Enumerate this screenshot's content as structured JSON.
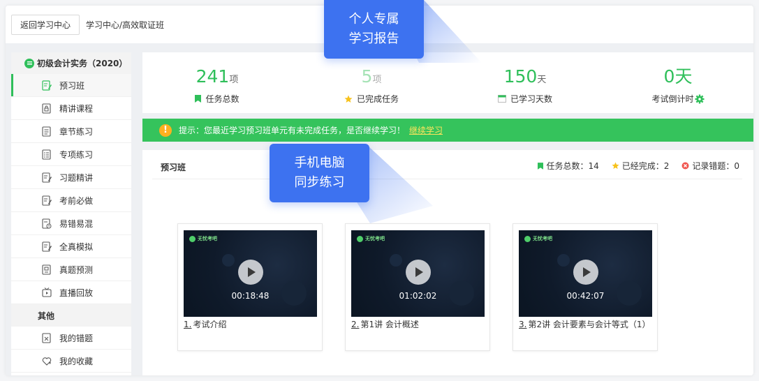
{
  "topbar": {
    "back_label": "返回学习中心",
    "breadcrumb": "学习中心/高效取证班"
  },
  "sidebar": {
    "course_title": "初级会计实务（2020）",
    "items": [
      {
        "label": "预习班",
        "icon": "edit-note-icon",
        "active": true
      },
      {
        "label": "精讲课程",
        "icon": "doc-lock-icon"
      },
      {
        "label": "章节练习",
        "icon": "doc-lines-icon"
      },
      {
        "label": "专项练习",
        "icon": "doc-list-icon"
      },
      {
        "label": "习题精讲",
        "icon": "doc-pen-icon"
      },
      {
        "label": "考前必做",
        "icon": "doc-pen-icon"
      },
      {
        "label": "易错易混",
        "icon": "doc-clock-icon"
      },
      {
        "label": "全真模拟",
        "icon": "doc-pen-icon"
      },
      {
        "label": "真题预测",
        "icon": "doc-box-icon"
      },
      {
        "label": "直播回放",
        "icon": "tv-icon"
      }
    ],
    "other_group": "其他",
    "other_items": [
      {
        "label": "我的错题",
        "icon": "doc-x-icon"
      },
      {
        "label": "我的收藏",
        "icon": "heart-plus-icon"
      }
    ]
  },
  "stats": [
    {
      "value": "241",
      "unit": "项",
      "label": "任务总数",
      "icon": "bookmark-icon",
      "faded": false
    },
    {
      "value": "5",
      "unit": "项",
      "label": "已完成任务",
      "icon": "star-icon",
      "faded": true
    },
    {
      "value": "150",
      "unit": "天",
      "label": "已学习天数",
      "icon": "calendar-icon",
      "faded": false
    },
    {
      "value": "0天",
      "unit": "",
      "label": "考试倒计时",
      "icon": "gear-icon",
      "faded": false
    }
  ],
  "banner": {
    "text": "提示：您最近学习预习班单元有未完成任务，是否继续学习！",
    "link": "继续学习"
  },
  "panel": {
    "title": "预习班",
    "counts": [
      {
        "label": "任务总数：14",
        "icon": "bookmark-icon"
      },
      {
        "label": "已经完成：2",
        "icon": "star-icon"
      },
      {
        "label": "记录错题：0",
        "icon": "error-circle-icon"
      }
    ],
    "cards": [
      {
        "index": "1.",
        "title": "考试介绍",
        "duration": "00:18:48",
        "logo": "无忧考吧"
      },
      {
        "index": "2.",
        "title": "第1讲 会计概述",
        "duration": "01:02:02",
        "logo": "无忧考吧"
      },
      {
        "index": "3.",
        "title": "第2讲 会计要素与会计等式（1）",
        "duration": "00:42:07",
        "logo": "无忧考吧"
      }
    ]
  },
  "callouts": [
    {
      "line1": "个人专属",
      "line2": "学习报告"
    },
    {
      "line1": "手机电脑",
      "line2": "同步练习"
    }
  ],
  "colors": {
    "accent": "#2fbf5a",
    "banner": "#35c35c",
    "callout": "#3d72f0",
    "warn": "#ffb020"
  }
}
